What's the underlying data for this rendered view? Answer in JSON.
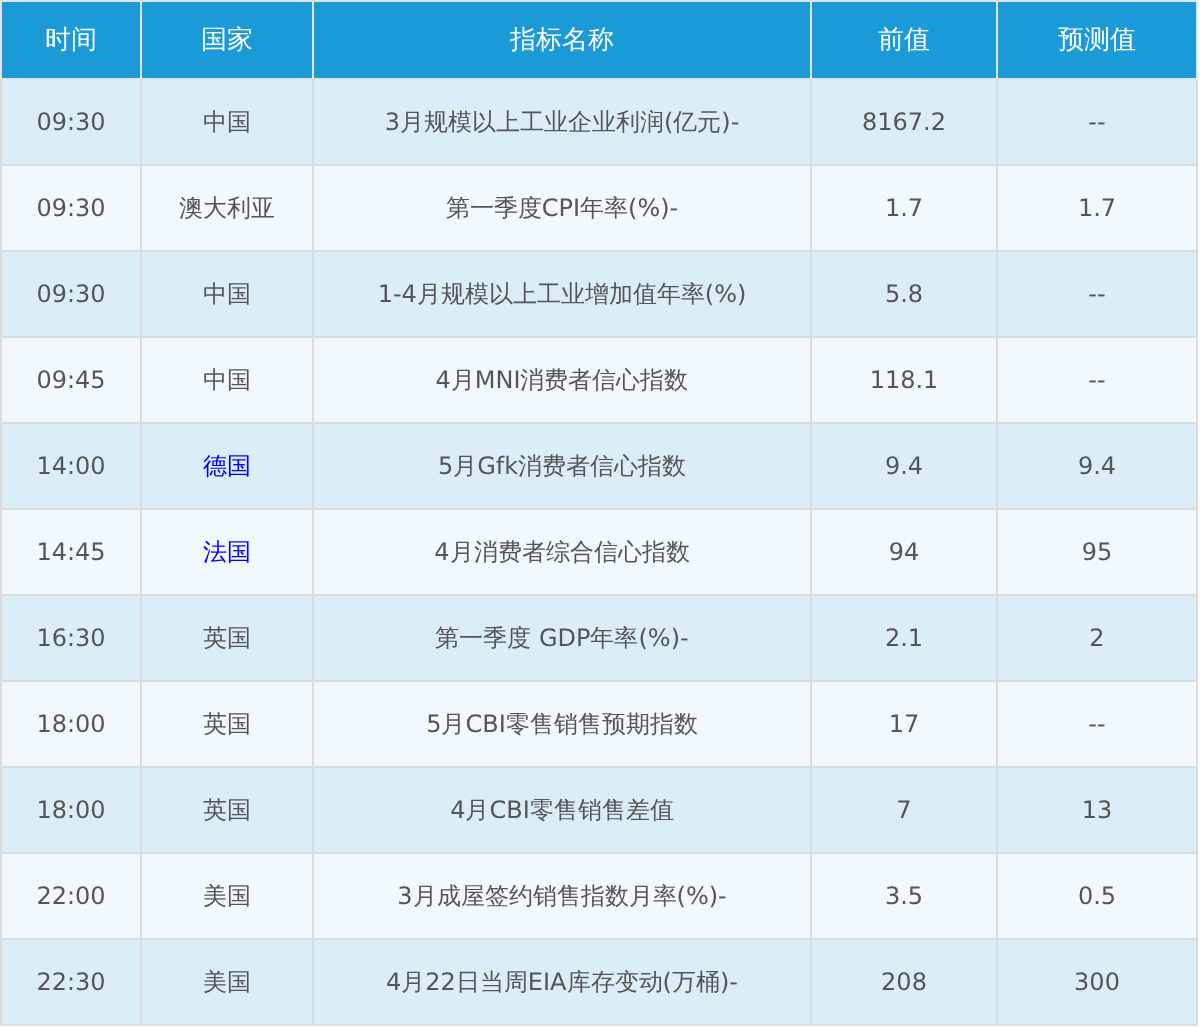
{
  "table": {
    "columns": [
      "时间",
      "国家",
      "指标名称",
      "前值",
      "预测值"
    ],
    "rows": [
      {
        "time": "09:30",
        "country": "中国",
        "link": false,
        "indicator": "3月规模以上工业企业利润(亿元)-",
        "previous": "8167.2",
        "forecast": "--"
      },
      {
        "time": "09:30",
        "country": "澳大利亚",
        "link": false,
        "indicator": "第一季度CPI年率(%)-",
        "previous": "1.7",
        "forecast": "1.7"
      },
      {
        "time": "09:30",
        "country": "中国",
        "link": false,
        "indicator": "1-4月规模以上工业增加值年率(%)",
        "previous": "5.8",
        "forecast": "--"
      },
      {
        "time": "09:45",
        "country": "中国",
        "link": false,
        "indicator": "4月MNI消费者信心指数",
        "previous": "118.1",
        "forecast": "--"
      },
      {
        "time": "14:00",
        "country": "德国",
        "link": true,
        "indicator": "5月Gfk消费者信心指数",
        "previous": "9.4",
        "forecast": "9.4"
      },
      {
        "time": "14:45",
        "country": "法国",
        "link": true,
        "indicator": "4月消费者综合信心指数",
        "previous": "94",
        "forecast": "95"
      },
      {
        "time": "16:30",
        "country": "英国",
        "link": false,
        "indicator": "第一季度 GDP年率(%)-",
        "previous": "2.1",
        "forecast": "2"
      },
      {
        "time": "18:00",
        "country": "英国",
        "link": false,
        "indicator": "5月CBI零售销售预期指数",
        "previous": "17",
        "forecast": "--"
      },
      {
        "time": "18:00",
        "country": "英国",
        "link": false,
        "indicator": "4月CBI零售销售差值",
        "previous": "7",
        "forecast": "13"
      },
      {
        "time": "22:00",
        "country": "美国",
        "link": false,
        "indicator": "3月成屋签约销售指数月率(%)-",
        "previous": "3.5",
        "forecast": "0.5"
      },
      {
        "time": "22:30",
        "country": "美国",
        "link": false,
        "indicator": "4月22日当周EIA库存变动(万桶)-",
        "previous": "208",
        "forecast": "300"
      }
    ]
  }
}
